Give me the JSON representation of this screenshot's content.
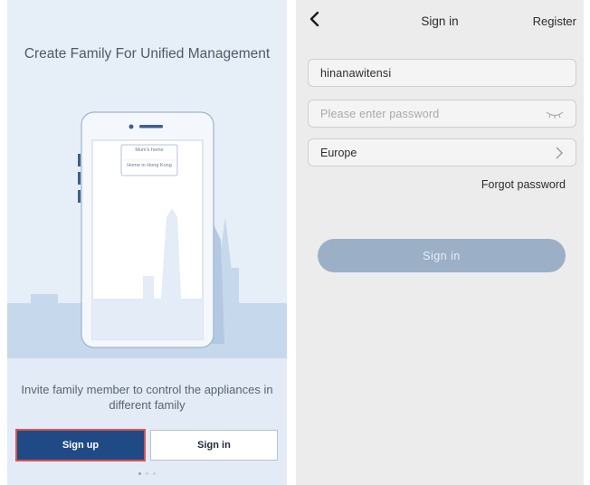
{
  "left": {
    "title": "Create Family For Unified Management",
    "phone_card": {
      "line1": "Mum's home",
      "line2": "Home in Hong Kong"
    },
    "invite_text": "Invite family member to control the appliances in different family",
    "signup_label": "Sign up",
    "signin_label": "Sign in",
    "page_indicator": {
      "total": 3,
      "active": 1
    }
  },
  "right": {
    "nav": {
      "title": "Sign in",
      "register_label": "Register"
    },
    "username_value": "hinanawitensi",
    "password_placeholder": "Please enter password",
    "region_value": "Europe",
    "forgot_label": "Forgot password",
    "signin_label": "Sign in"
  },
  "colors": {
    "signup_button": "#1f4a86",
    "signin_button_disabled": "#9bb0c7",
    "illustration_bg": "#e6eef8",
    "highlight_border": "#d9534f"
  }
}
